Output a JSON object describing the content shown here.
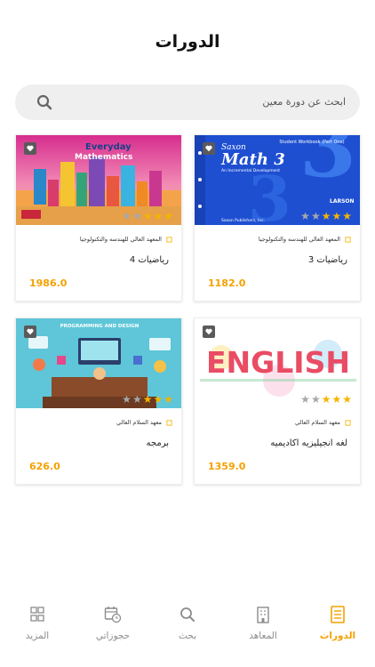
{
  "page_title": "الدورات",
  "search": {
    "placeholder": "ابحث عن دورة معين"
  },
  "courses": [
    {
      "institute": "المعهد العالي للهندسه والتكنولوجيا",
      "name": "رياضيات 3",
      "price": "1182.0",
      "rating": 3,
      "image": "math3-cover",
      "cover_text": [
        "Student Workbook (Part One)",
        "Saxon",
        "Math 3",
        "An Incremental Development",
        "LARSON",
        "Saxon Publishers, Inc."
      ]
    },
    {
      "institute": "المعهد العالي للهندسه والتكنولوجيا",
      "name": "رياضيات 4",
      "price": "1986.0",
      "rating": 3,
      "image": "everyday-mathematics-cover",
      "cover_text": [
        "Everyday",
        "Mathematics"
      ]
    },
    {
      "institute": "معهد السلام العالي",
      "name": "لغه انجيليزيه اكاديميه",
      "price": "1359.0",
      "rating": 3,
      "image": "english-splash-cover",
      "cover_text": [
        "ENGLISH"
      ]
    },
    {
      "institute": "معهد السلام العالي",
      "name": "برمجه",
      "price": "626.0",
      "rating": 3,
      "image": "programming-design-illustration",
      "cover_text": [
        "PROGRAMMING AND DESIGN"
      ]
    }
  ],
  "tabs": [
    {
      "label": "الدورات",
      "icon": "document-icon",
      "active": true
    },
    {
      "label": "المعاهد",
      "icon": "building-icon",
      "active": false
    },
    {
      "label": "بحث",
      "icon": "search-icon",
      "active": false
    },
    {
      "label": "حجوزاتي",
      "icon": "calendar-clock-icon",
      "active": false
    },
    {
      "label": "المزيد",
      "icon": "grid-icon",
      "active": false
    }
  ],
  "colors": {
    "accent": "#f4a100",
    "star": "#f4b400",
    "search_bg": "#efefef",
    "tab_inactive": "#8c8c8c"
  }
}
